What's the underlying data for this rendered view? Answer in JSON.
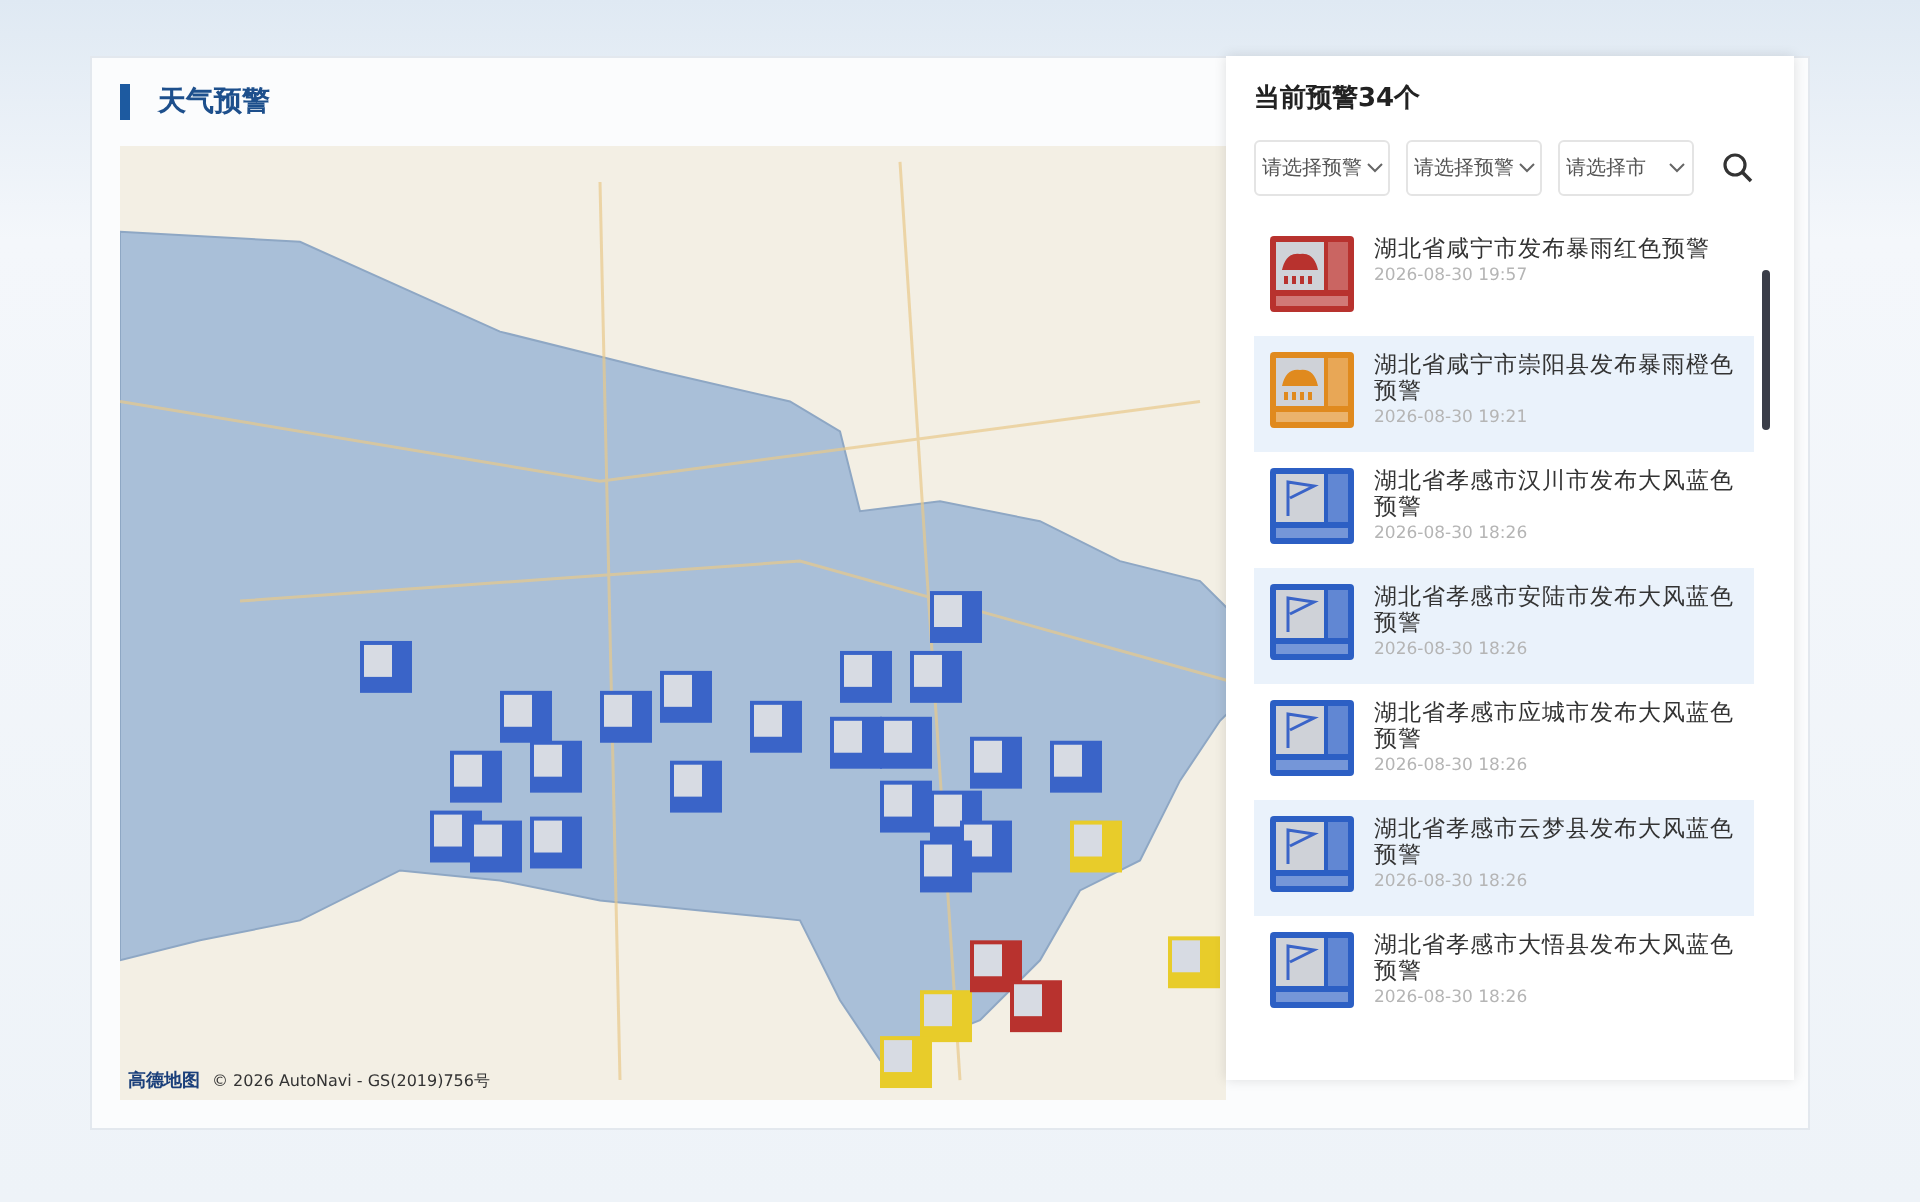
{
  "title": "天气预警",
  "map": {
    "attribution": "© 2026 AutoNavi - GS(2019)756号",
    "provider": "高德地图"
  },
  "panel": {
    "heading": "当前预警34个",
    "filters": [
      {
        "placeholder": "请选择预警"
      },
      {
        "placeholder": "请选择预警"
      },
      {
        "placeholder": "请选择市"
      }
    ],
    "alerts": [
      {
        "kind": "rain",
        "color": "#b8322e",
        "title": "湖北省咸宁市发布暴雨红色预警",
        "time": "2026-08-30 19:57"
      },
      {
        "kind": "rain",
        "color": "#e08a1e",
        "title": "湖北省咸宁市崇阳县发布暴雨橙色预警",
        "time": "2026-08-30 19:21"
      },
      {
        "kind": "gale",
        "color": "#2c5fc4",
        "title": "湖北省孝感市汉川市发布大风蓝色预警",
        "time": "2026-08-30 18:26"
      },
      {
        "kind": "gale",
        "color": "#2c5fc4",
        "title": "湖北省孝感市安陆市发布大风蓝色预警",
        "time": "2026-08-30 18:26"
      },
      {
        "kind": "gale",
        "color": "#2c5fc4",
        "title": "湖北省孝感市应城市发布大风蓝色预警",
        "time": "2026-08-30 18:26"
      },
      {
        "kind": "gale",
        "color": "#2c5fc4",
        "title": "湖北省孝感市云梦县发布大风蓝色预警",
        "time": "2026-08-30 18:26"
      },
      {
        "kind": "gale",
        "color": "#2c5fc4",
        "title": "湖北省孝感市大悟县发布大风蓝色预警",
        "time": "2026-08-30 18:26"
      }
    ]
  }
}
